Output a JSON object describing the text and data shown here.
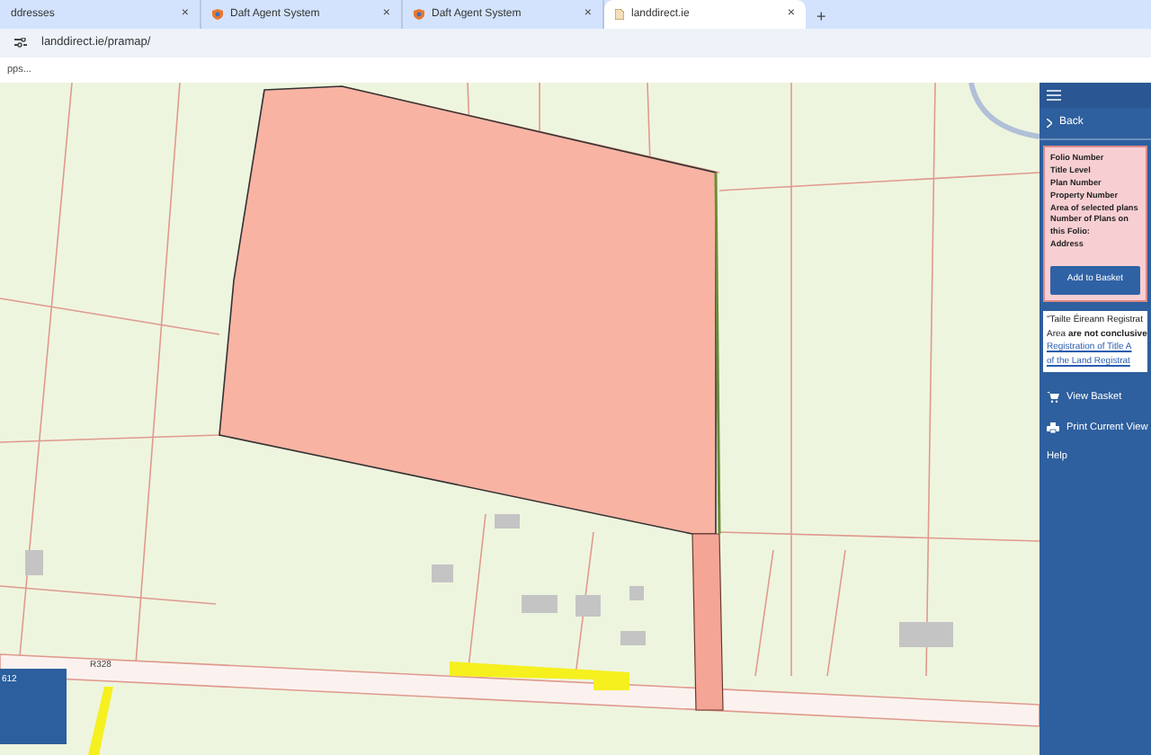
{
  "browser": {
    "tabs": [
      {
        "label": "ddresses",
        "kind": "plain",
        "selected": false
      },
      {
        "label": "Daft Agent System",
        "kind": "shield",
        "selected": false
      },
      {
        "label": "Daft Agent System",
        "kind": "shield",
        "selected": false
      },
      {
        "label": "landdirect.ie",
        "kind": "page",
        "selected": true
      }
    ],
    "new_tab": "+",
    "close": "×",
    "url": "landdirect.ie/pramap/",
    "bookmark": "pps..."
  },
  "map": {
    "road_label": "R328",
    "panel_text": "612"
  },
  "sidebar": {
    "back": "Back",
    "fields": [
      "Folio Number",
      "Title Level",
      "Plan Number",
      "Property Number",
      "Area of selected plans",
      "Number of Plans on this Folio:",
      "Address"
    ],
    "button": "Add to Basket",
    "note_lines": [
      {
        "kind": "text",
        "text": "\"Tailte Éireann Registrat"
      },
      {
        "kind": "text",
        "text": "Area **are not conclusive**"
      },
      {
        "kind": "link",
        "text": "Registration of Title A"
      },
      {
        "kind": "link",
        "text": "of the Land Registrat"
      }
    ],
    "links": [
      {
        "label": "View Basket",
        "kind": "cart"
      },
      {
        "label": "Print Current View",
        "kind": "printer"
      },
      {
        "label": "Help",
        "kind": "plain"
      }
    ]
  }
}
